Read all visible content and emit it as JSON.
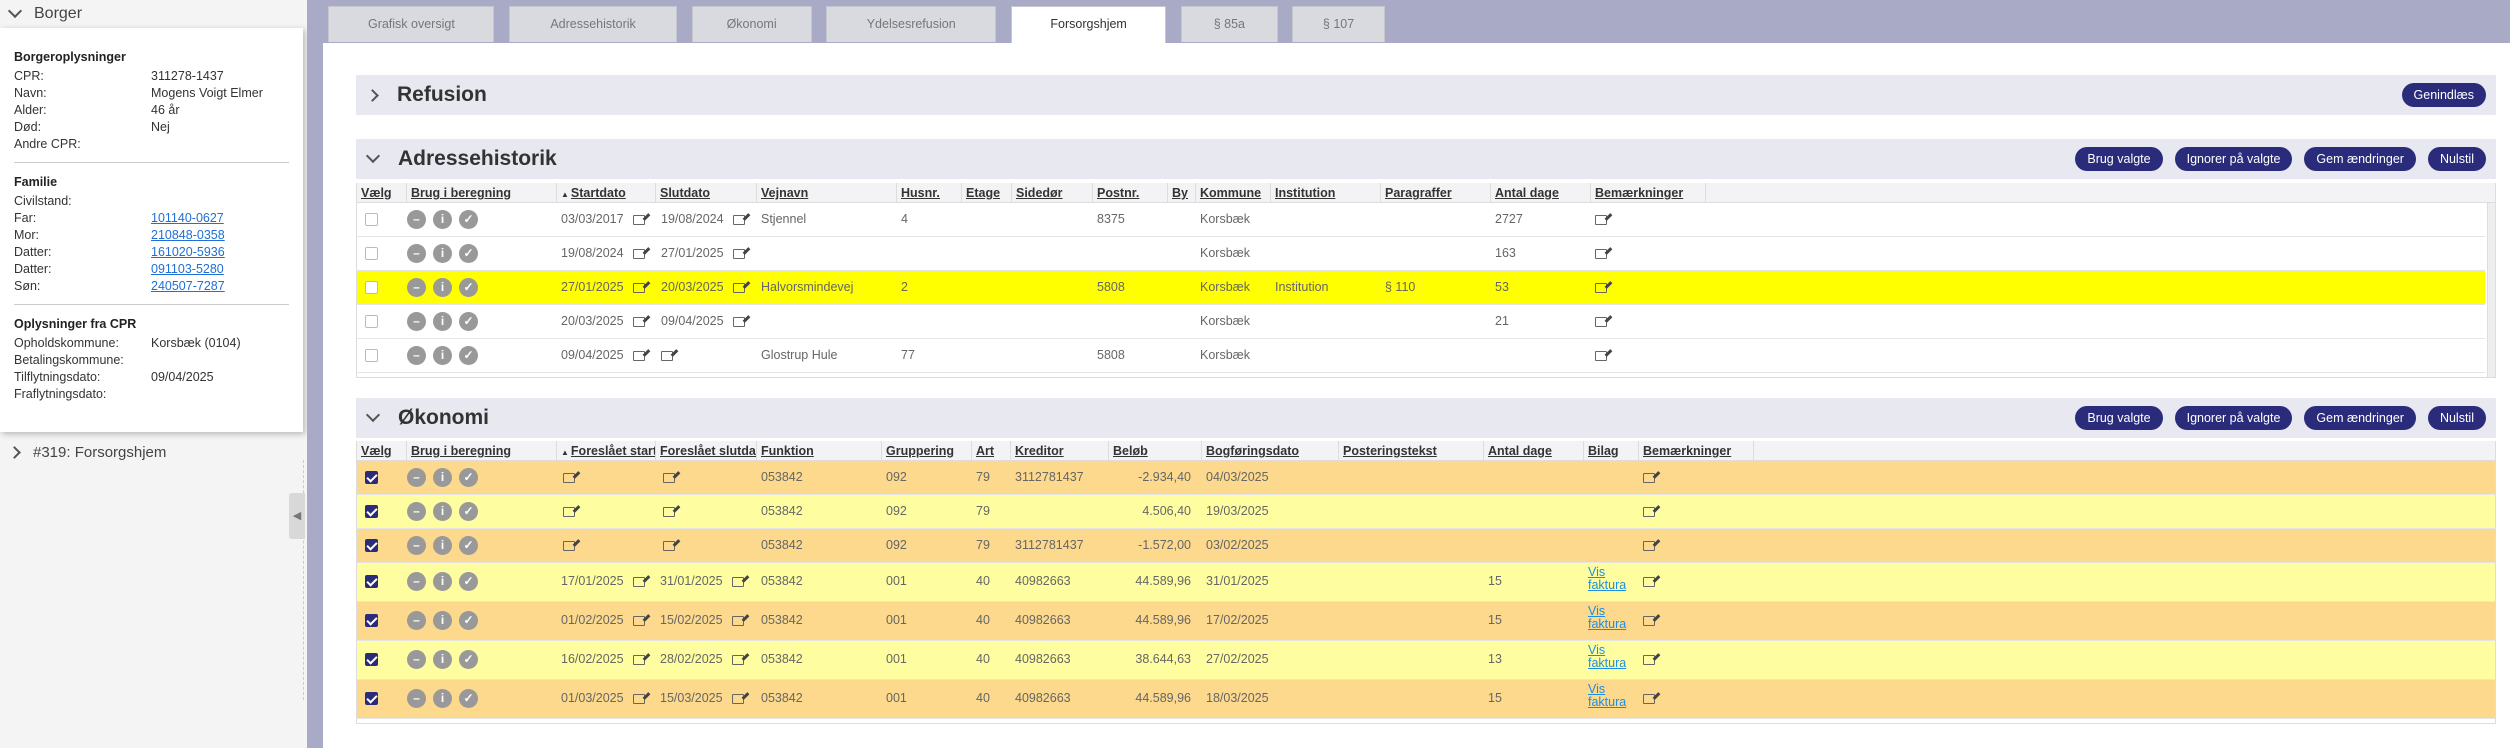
{
  "sidebar": {
    "title": "Borger",
    "borgeroplysninger": {
      "heading": "Borgeroplysninger",
      "rows": [
        {
          "k": "CPR:",
          "v": "311278-1437"
        },
        {
          "k": "Navn:",
          "v": "Mogens Voigt Elmer"
        },
        {
          "k": "Alder:",
          "v": "46 år"
        },
        {
          "k": "Død:",
          "v": "Nej"
        },
        {
          "k": "Andre CPR:",
          "v": ""
        }
      ]
    },
    "familie": {
      "heading": "Familie",
      "rows": [
        {
          "k": "Civilstand:",
          "v": "",
          "link": false
        },
        {
          "k": "Far:",
          "v": "101140-0627",
          "link": true
        },
        {
          "k": "Mor:",
          "v": "210848-0358",
          "link": true
        },
        {
          "k": "Datter:",
          "v": "161020-5936",
          "link": true
        },
        {
          "k": "Datter:",
          "v": "091103-5280",
          "link": true
        },
        {
          "k": "Søn:",
          "v": "240507-7287",
          "link": true
        }
      ]
    },
    "cpr": {
      "heading": "Oplysninger fra CPR",
      "rows": [
        {
          "k": "Opholdskommune:",
          "v": "Korsbæk (0104)"
        },
        {
          "k": "Betalingskommune:",
          "v": ""
        },
        {
          "k": "Tilflytningsdato:",
          "v": "09/04/2025"
        },
        {
          "k": "Fraflytningsdato:",
          "v": ""
        }
      ]
    },
    "case": "#319: Forsorgshjem"
  },
  "tabs": [
    "Grafisk oversigt",
    "Adressehistorik",
    "Økonomi",
    "Ydelsesrefusion",
    "Forsorgshjem",
    "§ 85a",
    "§ 107"
  ],
  "active_tab": "Forsorgshjem",
  "refusion": {
    "title": "Refusion",
    "button": "Genindlæs"
  },
  "adresse": {
    "title": "Adressehistorik",
    "buttons": [
      "Brug valgte",
      "Ignorer på valgte",
      "Gem ændringer",
      "Nulstil"
    ],
    "columns": [
      "Vælg",
      "Brug i beregning",
      "Startdato",
      "Slutdato",
      "Vejnavn",
      "Husnr.",
      "Etage",
      "Sidedør",
      "Postnr.",
      "By",
      "Kommune",
      "Institution",
      "Paragraffer",
      "Antal dage",
      "Bemærkninger"
    ],
    "rows": [
      {
        "start": "03/03/2017",
        "slut": "19/08/2024",
        "vej": "Stjennel",
        "hus": "4",
        "etage": "",
        "side": "",
        "post": "8375",
        "by": "",
        "kommune": "Korsbæk",
        "inst": "",
        "para": "",
        "dage": "2727",
        "hl": false
      },
      {
        "start": "19/08/2024",
        "slut": "27/01/2025",
        "vej": "",
        "hus": "",
        "etage": "",
        "side": "",
        "post": "",
        "by": "",
        "kommune": "Korsbæk",
        "inst": "",
        "para": "",
        "dage": "163",
        "hl": false
      },
      {
        "start": "27/01/2025",
        "slut": "20/03/2025",
        "vej": "Halvorsmindevej",
        "hus": "2",
        "etage": "",
        "side": "",
        "post": "5808",
        "by": "",
        "kommune": "Korsbæk",
        "inst": "Institution",
        "para": "§ 110",
        "dage": "53",
        "hl": true
      },
      {
        "start": "20/03/2025",
        "slut": "09/04/2025",
        "vej": "",
        "hus": "",
        "etage": "",
        "side": "",
        "post": "",
        "by": "",
        "kommune": "Korsbæk",
        "inst": "",
        "para": "",
        "dage": "21",
        "hl": false
      },
      {
        "start": "09/04/2025",
        "slut": "",
        "vej": "Glostrup Hule",
        "hus": "77",
        "etage": "",
        "side": "",
        "post": "5808",
        "by": "",
        "kommune": "Korsbæk",
        "inst": "",
        "para": "",
        "dage": "",
        "hl": false
      }
    ]
  },
  "okonomi": {
    "title": "Økonomi",
    "buttons": [
      "Brug valgte",
      "Ignorer på valgte",
      "Gem ændringer",
      "Nulstil"
    ],
    "columns": [
      "Vælg",
      "Brug i beregning",
      "Foreslået start",
      "Foreslået slutdato",
      "Funktion",
      "Gruppering",
      "Art",
      "Kreditor",
      "Beløb",
      "Bogføringsdato",
      "Posteringstekst",
      "Antal dage",
      "Bilag",
      "Bemærkninger"
    ],
    "rows": [
      {
        "fstart": "",
        "fslut": "",
        "funk": "053842",
        "grp": "092",
        "art": "79",
        "kred": "3112781437",
        "belob": "-2.934,40",
        "bog": "04/03/2025",
        "post": "",
        "dage": "",
        "bilag": "",
        "tall": false
      },
      {
        "fstart": "",
        "fslut": "",
        "funk": "053842",
        "grp": "092",
        "art": "79",
        "kred": "",
        "belob": "4.506,40",
        "bog": "19/03/2025",
        "post": "",
        "dage": "",
        "bilag": "",
        "tall": false
      },
      {
        "fstart": "",
        "fslut": "",
        "funk": "053842",
        "grp": "092",
        "art": "79",
        "kred": "3112781437",
        "belob": "-1.572,00",
        "bog": "03/02/2025",
        "post": "",
        "dage": "",
        "bilag": "",
        "tall": false
      },
      {
        "fstart": "17/01/2025",
        "fslut": "31/01/2025",
        "funk": "053842",
        "grp": "001",
        "art": "40",
        "kred": "40982663",
        "belob": "44.589,96",
        "bog": "31/01/2025",
        "post": "",
        "dage": "15",
        "bilag": "Vis faktura",
        "tall": true
      },
      {
        "fstart": "01/02/2025",
        "fslut": "15/02/2025",
        "funk": "053842",
        "grp": "001",
        "art": "40",
        "kred": "40982663",
        "belob": "44.589,96",
        "bog": "17/02/2025",
        "post": "",
        "dage": "15",
        "bilag": "Vis faktura",
        "tall": true
      },
      {
        "fstart": "16/02/2025",
        "fslut": "28/02/2025",
        "funk": "053842",
        "grp": "001",
        "art": "40",
        "kred": "40982663",
        "belob": "38.644,63",
        "bog": "27/02/2025",
        "post": "",
        "dage": "13",
        "bilag": "Vis faktura",
        "tall": true
      },
      {
        "fstart": "01/03/2025",
        "fslut": "15/03/2025",
        "funk": "053842",
        "grp": "001",
        "art": "40",
        "kred": "40982663",
        "belob": "44.589,96",
        "bog": "18/03/2025",
        "post": "",
        "dage": "15",
        "bilag": "Vis faktura",
        "tall": true
      }
    ]
  },
  "colors": {
    "accent": "#2b2b7c",
    "highlight_yellow": "#ffff00",
    "row_orange": "#fcd98c",
    "row_yellow": "#fefea0"
  }
}
